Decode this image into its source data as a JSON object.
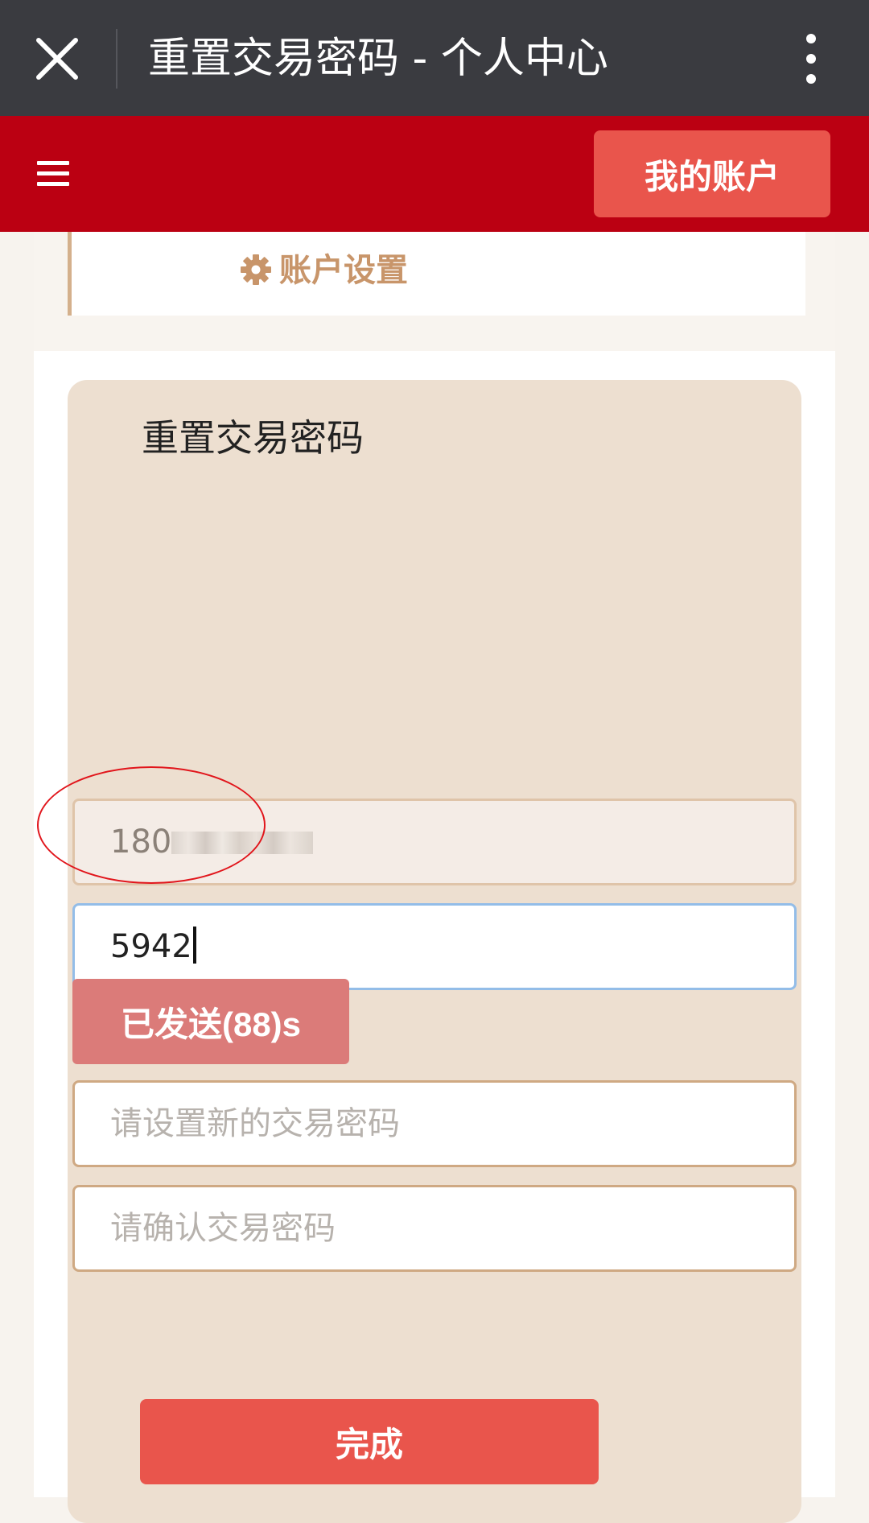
{
  "webview": {
    "title": "重置交易密码 - 个人中心",
    "close_icon": "close-icon",
    "more_icon": "more-vertical-icon"
  },
  "header": {
    "menu_icon": "hamburger-menu-icon",
    "account_button_label": "我的账户",
    "brand_color": "#bb0012",
    "account_button_color": "#e9554c"
  },
  "settings_tab": {
    "icon": "gear-icon",
    "label": "账户设置",
    "label_color": "#c8956a"
  },
  "form": {
    "title": "重置交易密码",
    "phone_number_prefix": "180",
    "phone_number_obscured": true,
    "verification_code_value": "5942",
    "send_code_button_label": "已发送(88)s",
    "new_password_placeholder": "请设置新的交易密码",
    "confirm_password_placeholder": "请确认交易密码",
    "submit_label": "完成",
    "card_color": "#eddfd0",
    "annotation_color": "#e1151b"
  }
}
